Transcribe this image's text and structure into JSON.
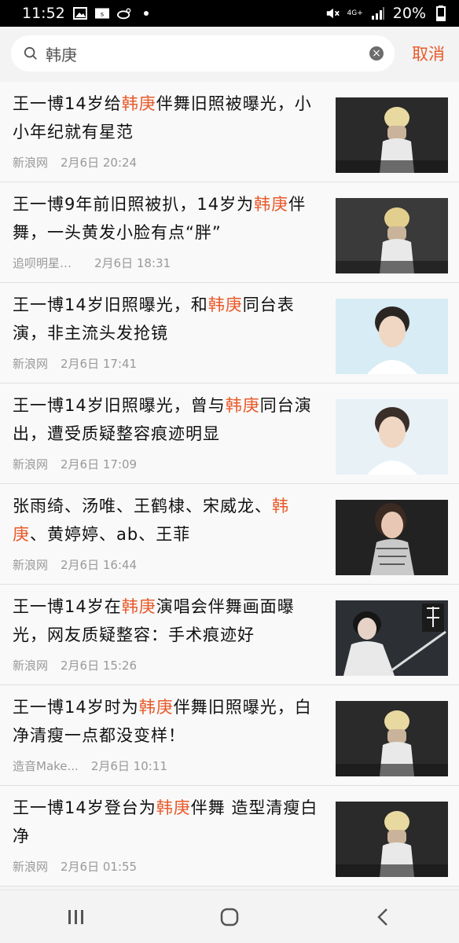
{
  "status": {
    "time": "11:52",
    "network": "4G+",
    "battery": "20%"
  },
  "search": {
    "query": "韩庚",
    "cancel_label": "取消"
  },
  "results": [
    {
      "title_parts": [
        "王一博14岁给",
        "韩庚",
        "伴舞旧照被曝光，小小年纪就有星范"
      ],
      "source": "新浪网",
      "time": "2月6日 20:24"
    },
    {
      "title_parts": [
        "王一博9年前旧照被扒，14岁为",
        "韩庚",
        "伴舞，一头黄发小脸有点“胖”"
      ],
      "source": "追呗明星娱...",
      "time": "2月6日 18:31"
    },
    {
      "title_parts": [
        "王一博14岁旧照曝光，和",
        "韩庚",
        "同台表演，非主流头发抢镜"
      ],
      "source": "新浪网",
      "time": "2月6日 17:41"
    },
    {
      "title_parts": [
        "王一博14岁旧照曝光，曾与",
        "韩庚",
        "同台演出，遭受质疑整容痕迹明显"
      ],
      "source": "新浪网",
      "time": "2月6日 17:09"
    },
    {
      "title_parts": [
        "张雨绮、汤唯、王鹤棣、宋威龙、",
        "韩庚",
        "、黄婷婷、ab、王菲"
      ],
      "source": "新浪网",
      "time": "2月6日 16:44"
    },
    {
      "title_parts": [
        "王一博14岁在",
        "韩庚",
        "演唱会伴舞画面曝光，网友质疑整容：手术痕迹好"
      ],
      "source": "新浪网",
      "time": "2月6日 15:26"
    },
    {
      "title_parts": [
        "王一博14岁时为",
        "韩庚",
        "伴舞旧照曝光，白净清瘦一点都没变样！"
      ],
      "source": "造音Make...",
      "time": "2月6日 10:11"
    },
    {
      "title_parts": [
        "王一博14岁登台为",
        "韩庚",
        "伴舞 造型清瘦白净"
      ],
      "source": "新浪网",
      "time": "2月6日 01:55"
    }
  ],
  "thumbs": [
    {
      "bg": "#2a2a2a",
      "accent": "#e8d9a0",
      "type": "stage"
    },
    {
      "bg": "#3a3a3a",
      "accent": "#e3cf8d",
      "type": "stage"
    },
    {
      "bg": "#d7ecf5",
      "accent": "#2b2522",
      "type": "portrait"
    },
    {
      "bg": "#e7f1f6",
      "accent": "#3a2e28",
      "type": "portrait"
    },
    {
      "bg": "#222222",
      "accent": "#c9c9c9",
      "type": "portrait-dark"
    },
    {
      "bg": "#2c2f34",
      "accent": "#e9e9e9",
      "type": "poster"
    },
    {
      "bg": "#2a2a2a",
      "accent": "#e8d9a0",
      "type": "stage"
    },
    {
      "bg": "#2a2a2a",
      "accent": "#e8d9a0",
      "type": "stage"
    }
  ],
  "nav": {
    "recent_icon": "recent-apps-icon",
    "home_icon": "home-icon",
    "back_icon": "back-icon"
  }
}
